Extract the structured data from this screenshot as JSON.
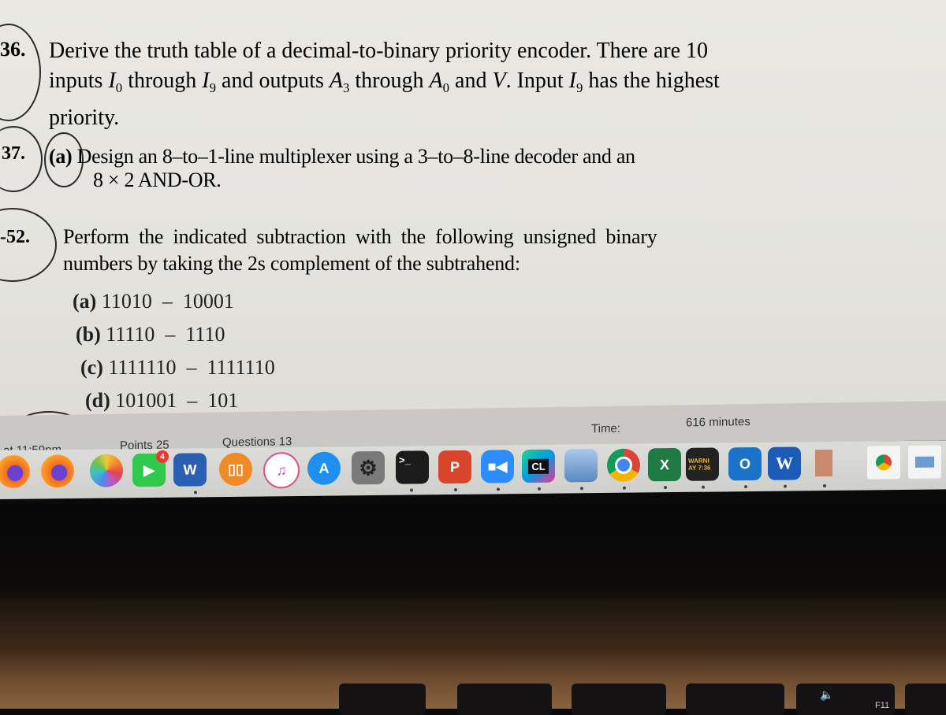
{
  "problems": [
    {
      "number": "36.",
      "text_line1": "Derive the truth table of a decimal-to-binary priority encoder. There are 10",
      "text_line2_parts": [
        "inputs ",
        "I",
        "0",
        " through ",
        "I",
        "9",
        " and outputs ",
        "A",
        "3",
        " through ",
        "A",
        "0",
        " and ",
        "V",
        ". Input ",
        "I",
        "9",
        " has the highest"
      ],
      "text_line3": "priority."
    },
    {
      "number": "37.",
      "part": "(a)",
      "text_line1": "Design an 8–to–1-line multiplexer using a 3–to–8-line decoder and an",
      "text_line2": "8 × 2 AND-OR."
    },
    {
      "number": "-52.",
      "text_line1": "Perform the indicated subtraction with the following unsigned binary",
      "text_line2": "numbers by taking the 2s complement of the subtrahend:",
      "items": [
        {
          "label": "(a)",
          "expr": "11010  –  10001"
        },
        {
          "label": "(b)",
          "expr": "11110  –  1110"
        },
        {
          "label": "(c)",
          "expr": "1111110  –  1111110"
        },
        {
          "label": "(d)",
          "expr": "101001  –  101"
        }
      ]
    }
  ],
  "status_bar": {
    "due": "at 11:59pm",
    "points": "Points 25",
    "questions": "Questions 13",
    "time_label": "Time:",
    "time_value": "616 minutes"
  },
  "dock": {
    "apps": [
      {
        "name": "Firefox",
        "icon": "firefox-icon",
        "color": "#f26b21"
      },
      {
        "name": "Firefox",
        "icon": "firefox-icon",
        "color": "#f26b21"
      },
      {
        "name": "Photos",
        "icon": "photos-icon",
        "color": "#f0f0f0"
      },
      {
        "name": "FaceTime",
        "icon": "facetime-icon",
        "color": "#2fc94b",
        "badge": "4"
      },
      {
        "name": "Microsoft Word",
        "icon": "word-icon",
        "color": "#2b5fb4",
        "glyph": "W"
      },
      {
        "name": "Books",
        "icon": "books-icon",
        "color": "#f08a24"
      },
      {
        "name": "Music",
        "icon": "music-icon",
        "color": "#ffffff"
      },
      {
        "name": "App Store",
        "icon": "app-store-icon",
        "color": "#1f8ef1"
      },
      {
        "name": "System Preferences",
        "icon": "system-preferences-icon",
        "color": "#7a7a7a"
      },
      {
        "name": "Terminal",
        "icon": "terminal-icon",
        "color": "#1b1b1b",
        "glyph": ">_"
      },
      {
        "name": "Microsoft PowerPoint",
        "icon": "powerpoint-icon",
        "color": "#d9452b",
        "glyph": "P"
      },
      {
        "name": "Zoom",
        "icon": "zoom-icon",
        "color": "#2d8cff"
      },
      {
        "name": "CLion",
        "icon": "clion-icon",
        "color": "#111111",
        "glyph": "CL"
      },
      {
        "name": "Preview",
        "icon": "preview-icon",
        "color": "#6c9bd1"
      },
      {
        "name": "Google Chrome",
        "icon": "chrome-icon",
        "color": "#ffffff"
      },
      {
        "name": "Microsoft Excel",
        "icon": "excel-icon",
        "color": "#1f7a44",
        "glyph": "X"
      },
      {
        "name": "Console",
        "icon": "console-icon",
        "color": "#222222",
        "glyph": "WARNI AY 7:36"
      },
      {
        "name": "Microsoft Outlook",
        "icon": "outlook-icon",
        "color": "#1a73c9",
        "glyph": "O"
      },
      {
        "name": "Word document",
        "icon": "word-doc-icon",
        "color": "#1c5bb8",
        "glyph": "W"
      },
      {
        "name": "Archive Utility",
        "icon": "archive-icon",
        "color": "#c98a6c"
      },
      {
        "name": "Chrome document",
        "icon": "chrome-doc-icon",
        "color": "#f4f4f4"
      },
      {
        "name": "JPEG document",
        "icon": "jpeg-doc-icon",
        "color": "#f4f4f4"
      }
    ]
  },
  "keyboard": {
    "f11_label": "F11"
  }
}
